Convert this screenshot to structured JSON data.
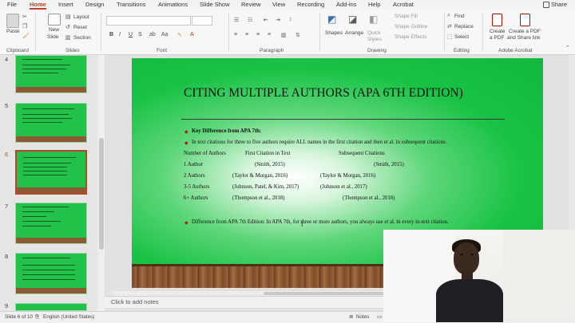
{
  "tabs": [
    "File",
    "Home",
    "Insert",
    "Design",
    "Transitions",
    "Animations",
    "Slide Show",
    "Review",
    "View",
    "Recording",
    "Add-ins",
    "Help",
    "Acrobat"
  ],
  "active_tab": "Home",
  "share_label": "Share",
  "ribbon": {
    "clipboard": {
      "paste": "Paste",
      "label": "Clipboard"
    },
    "slides": {
      "new_slide_line1": "New",
      "new_slide_line2": "Slide",
      "layout": "Layout",
      "reset": "Reset",
      "section": "Section",
      "label": "Slides"
    },
    "font": {
      "label": "Font",
      "bold": "B",
      "italic": "I",
      "underline": "U",
      "strike": "S"
    },
    "paragraph": {
      "label": "Paragraph"
    },
    "drawing": {
      "shapes": "Shapes",
      "arrange": "Arrange",
      "quick_styles": "Quick Styles",
      "shape_fill": "Shape Fill",
      "shape_outline": "Shape Outline",
      "shape_effects": "Shape Effects",
      "label": "Drawing"
    },
    "editing": {
      "find": "Find",
      "replace": "Replace",
      "select": "Select",
      "label": "Editing"
    },
    "acrobat": {
      "create_pdf_line1": "Create",
      "create_pdf_line2": "a PDF",
      "create_share_line1": "Create a PDF",
      "create_share_line2": "and Share link",
      "label": "Adobe Acrobat"
    }
  },
  "thumbnails": [
    {
      "num": "4",
      "selected": false
    },
    {
      "num": "5",
      "selected": false
    },
    {
      "num": "6",
      "selected": true
    },
    {
      "num": "7",
      "selected": false
    },
    {
      "num": "8",
      "selected": false
    },
    {
      "num": "9",
      "selected": false
    }
  ],
  "slide": {
    "title": "CITING MULTIPLE AUTHORS (APA 6TH EDITION)",
    "key_difference": "Key Difference from APA 7th:",
    "intro": "In text citations for three to five authors require ALL names in the first citation and then et al. in subsequent citations.",
    "headers": [
      "Number of Authors",
      "First Citation in Text",
      "Subsequent Citations"
    ],
    "rows": [
      [
        "1 Author",
        "(Smith, 2015)",
        "(Smith, 2015)"
      ],
      [
        "2 Authors",
        "(Taylor & Morgan, 2016)",
        "(Taylor & Morgan, 2016)"
      ],
      [
        "3-5 Authors",
        "(Johnson, Patel, & Kim, 2017)",
        "(Johnson et al., 2017)"
      ],
      [
        "6+ Authors",
        "(Thompson et al., 2018)",
        "(Thompson et al., 2018)"
      ]
    ],
    "difference": "Difference from APA 7th Edition: In APA 7th, for three or more authors, you always use et al. in every in-text citation."
  },
  "notes_placeholder": "Click to add notes",
  "status": {
    "slide_info": "Slide 6 of 10",
    "language": "English (United States)",
    "notes_btn": "Notes"
  },
  "colors": {
    "accent": "#b7472a",
    "slide_green": "#17c244"
  }
}
